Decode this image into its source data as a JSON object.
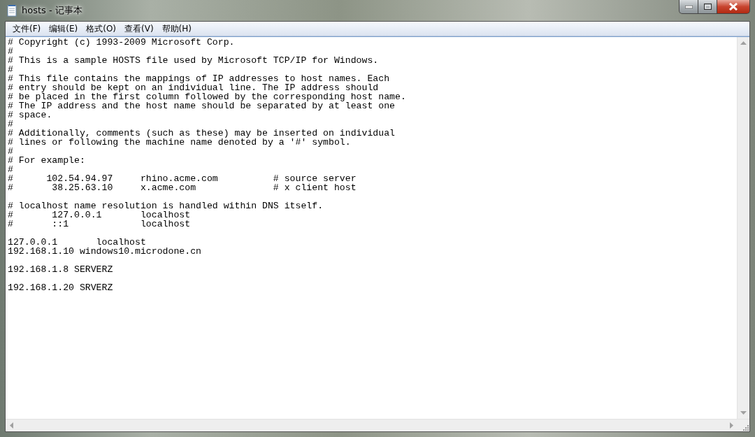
{
  "window": {
    "title": "hosts - 记事本"
  },
  "menu": [
    "文件(F)",
    "编辑(E)",
    "格式(O)",
    "查看(V)",
    "帮助(H)"
  ],
  "editor": {
    "blocks": [
      [
        "# Copyright (c) 1993-2009 Microsoft Corp.",
        "#",
        "# This is a sample HOSTS file used by Microsoft TCP/IP for Windows.",
        "#",
        "# This file contains the mappings of IP addresses to host names. Each",
        "# entry should be kept on an individual line. The IP address should",
        "# be placed in the first column followed by the corresponding host name.",
        "# The IP address and the host name should be separated by at least one",
        "# space.",
        "#",
        "# Additionally, comments (such as these) may be inserted on individual",
        "# lines or following the machine name denoted by a '#' symbol.",
        "#",
        "# For example:",
        "#",
        "#      102.54.94.97     rhino.acme.com          # source server",
        "#       38.25.63.10     x.acme.com              # x client host"
      ],
      [
        "# localhost name resolution is handled within DNS itself.",
        "#       127.0.0.1       localhost",
        "#       ::1             localhost"
      ],
      [
        "127.0.0.1       localhost",
        "192.168.1.10 windows10.microdone.cn"
      ],
      [
        "192.168.1.8 SERVERZ"
      ],
      [
        "192.168.1.20 SRVERZ"
      ]
    ]
  }
}
